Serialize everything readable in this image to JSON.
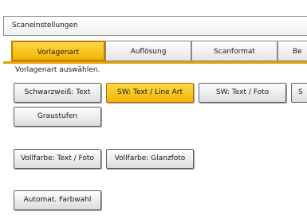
{
  "title": "Scaneinstellungen",
  "tabs": [
    {
      "label": "Vorlagenart",
      "active": true
    },
    {
      "label": "Auflösung",
      "active": false
    },
    {
      "label": "Scanformat",
      "active": false
    },
    {
      "label": "Be",
      "active": false
    }
  ],
  "section_label": "Vorlagenart auswählen.",
  "options": [
    {
      "label": "Schwarzweiß: Text",
      "selected": false
    },
    {
      "label": "SW: Text / Line Art",
      "selected": true
    },
    {
      "label": "SW: Text / Foto",
      "selected": false
    },
    {
      "label": "S",
      "selected": false
    },
    {
      "label": "Graustufen",
      "selected": false
    },
    {
      "label": "Vollfarbe: Text / Foto",
      "selected": false
    },
    {
      "label": "Vollfarbe: Glanzfoto",
      "selected": false
    },
    {
      "label": "Automat. Farbwahl",
      "selected": false
    }
  ],
  "colors": {
    "accent": "#f2b400",
    "accent_border": "#c97a00"
  }
}
